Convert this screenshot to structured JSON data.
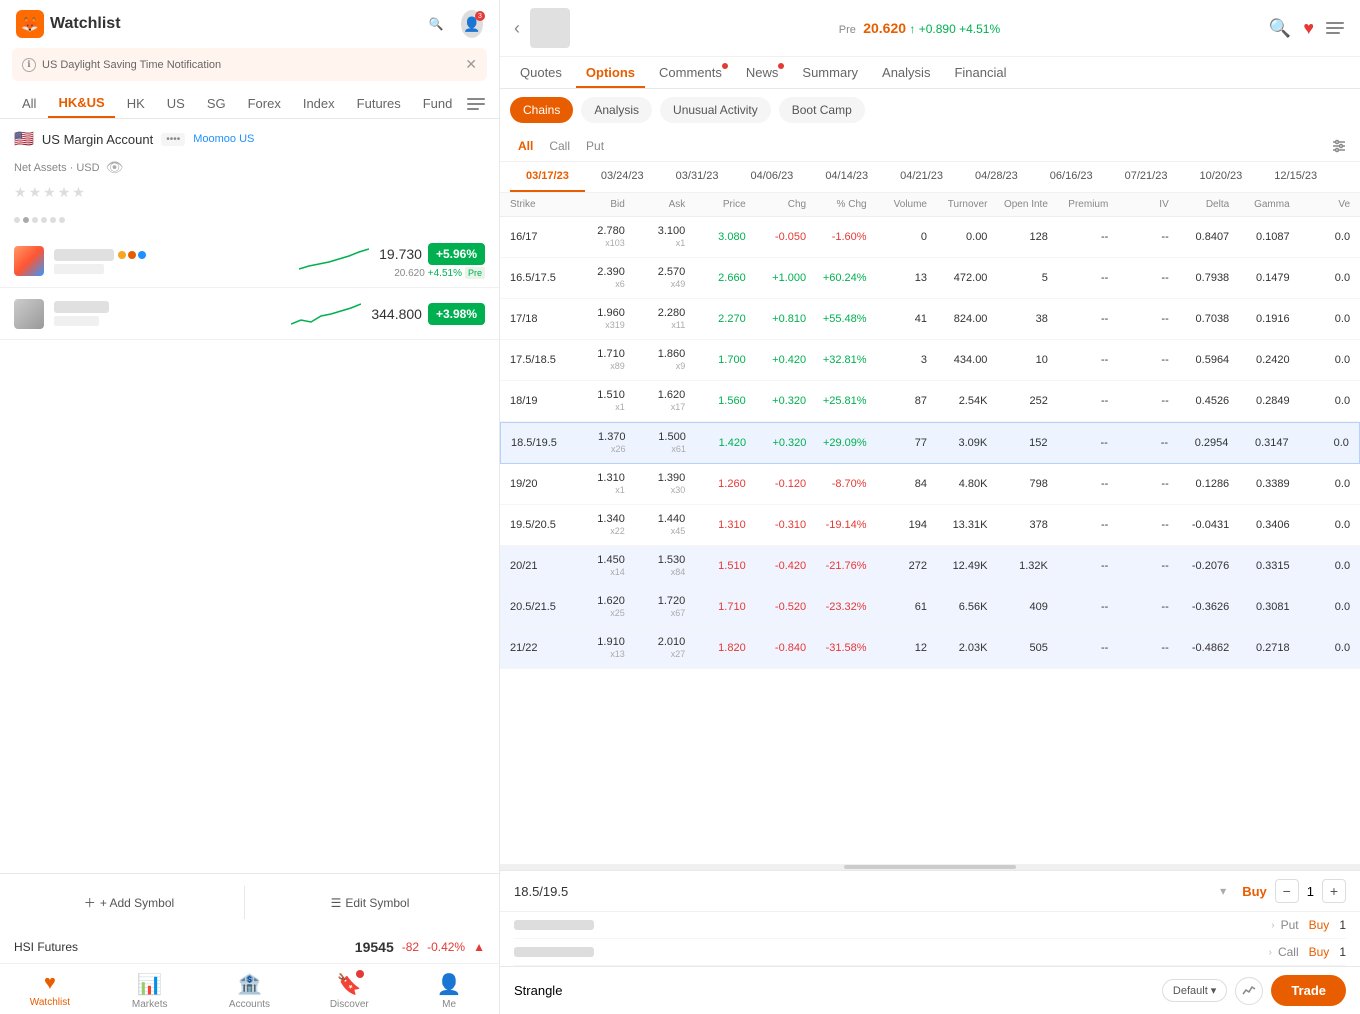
{
  "app": {
    "logo": "🦊",
    "title": "Watchlist"
  },
  "notification": {
    "text": "US Daylight Saving Time Notification",
    "icon": "ℹ"
  },
  "tabs": [
    {
      "label": "All",
      "active": false
    },
    {
      "label": "HK&US",
      "active": true
    },
    {
      "label": "HK",
      "active": false
    },
    {
      "label": "US",
      "active": false
    },
    {
      "label": "SG",
      "active": false
    },
    {
      "label": "Forex",
      "active": false
    },
    {
      "label": "Index",
      "active": false
    },
    {
      "label": "Futures",
      "active": false
    },
    {
      "label": "Funds",
      "active": false
    }
  ],
  "account": {
    "flag": "🇺🇸",
    "name": "US Margin Account",
    "badge": "••••",
    "broker": "Moomoo US",
    "assets_label": "Net Assets · USD"
  },
  "stocks": [
    {
      "price": "19.730",
      "change": "+5.96%",
      "sub_price": "20.620",
      "sub_change": "+4.51%",
      "sub_label": "Pre",
      "badge_color": "badge-green"
    },
    {
      "price": "344.800",
      "change": "+3.98%",
      "badge_color": "badge-green2"
    }
  ],
  "actions": {
    "add_symbol": "+ Add Symbol",
    "edit_symbol": "Edit Symbol"
  },
  "hsi": {
    "label": "HSI Futures",
    "price": "19545",
    "change": "-82",
    "pct": "-0.42%"
  },
  "nav": [
    {
      "label": "Watchlist",
      "icon": "♥",
      "active": true
    },
    {
      "label": "Markets",
      "icon": "📊",
      "active": false
    },
    {
      "label": "Accounts",
      "icon": "🏦",
      "active": false
    },
    {
      "label": "Discover",
      "icon": "🔍",
      "active": false,
      "badge": true
    },
    {
      "label": "Me",
      "icon": "👤",
      "active": false
    }
  ],
  "right_header": {
    "pre_label": "Pre",
    "price": "20.620",
    "change": "+0.890",
    "pct": "+4.51%"
  },
  "main_tabs": [
    {
      "label": "Quotes",
      "active": false
    },
    {
      "label": "Options",
      "active": true
    },
    {
      "label": "Comments",
      "active": false,
      "dot": true
    },
    {
      "label": "News",
      "active": false,
      "dot": true
    },
    {
      "label": "Summary",
      "active": false
    },
    {
      "label": "Analysis",
      "active": false
    },
    {
      "label": "Financial",
      "active": false
    }
  ],
  "subtabs": [
    {
      "label": "Chains",
      "active": true
    },
    {
      "label": "Analysis",
      "active": false
    },
    {
      "label": "Unusual Activity",
      "active": false
    },
    {
      "label": "Boot Camp",
      "active": false
    }
  ],
  "filters": [
    {
      "label": "All",
      "active": true
    },
    {
      "label": "Call",
      "active": false
    },
    {
      "label": "Put",
      "active": false
    }
  ],
  "dates": [
    {
      "date": "03/17/23",
      "active": true
    },
    {
      "date": "03/24/23",
      "active": false
    },
    {
      "date": "03/31/23",
      "active": false
    },
    {
      "date": "04/06/23",
      "active": false
    },
    {
      "date": "04/14/23",
      "active": false
    },
    {
      "date": "04/21/23",
      "active": false
    },
    {
      "date": "04/28/23",
      "active": false
    },
    {
      "date": "06/16/23",
      "active": false
    },
    {
      "date": "07/21/23",
      "active": false
    },
    {
      "date": "10/20/23",
      "active": false
    },
    {
      "date": "12/15/23",
      "active": false
    }
  ],
  "table_headers": [
    "Strike",
    "Bid",
    "Ask",
    "Price",
    "Chg",
    "% Chg",
    "Volume",
    "Turnover",
    "Open Inte",
    "Premium",
    "IV",
    "Delta",
    "Gamma",
    "Ve"
  ],
  "rows": [
    {
      "strike": "16/17",
      "bid": "2.780",
      "bid_x": "x103",
      "ask": "3.100",
      "ask_x": "x1",
      "price": "3.080",
      "chg": "-0.050",
      "pct_chg": "-1.60%",
      "volume": "0",
      "turnover": "0.00",
      "open_int": "128",
      "premium": "--",
      "iv": "--",
      "delta": "0.8407",
      "gamma": "0.1087",
      "ve": "0.0",
      "shaded": false,
      "highlighted": false
    },
    {
      "strike": "16.5/17.5",
      "bid": "2.390",
      "bid_x": "x6",
      "ask": "2.570",
      "ask_x": "x49",
      "price": "2.660",
      "chg": "+1.000",
      "pct_chg": "+60.24%",
      "volume": "13",
      "turnover": "472.00",
      "open_int": "5",
      "premium": "--",
      "iv": "--",
      "delta": "0.7938",
      "gamma": "0.1479",
      "ve": "0.0",
      "shaded": false,
      "highlighted": false
    },
    {
      "strike": "17/18",
      "bid": "1.960",
      "bid_x": "x319",
      "ask": "2.280",
      "ask_x": "x11",
      "price": "2.270",
      "chg": "+0.810",
      "pct_chg": "+55.48%",
      "volume": "41",
      "turnover": "824.00",
      "open_int": "38",
      "premium": "--",
      "iv": "--",
      "delta": "0.7038",
      "gamma": "0.1916",
      "ve": "0.0",
      "shaded": false,
      "highlighted": false
    },
    {
      "strike": "17.5/18.5",
      "bid": "1.710",
      "bid_x": "x89",
      "ask": "1.860",
      "ask_x": "x9",
      "price": "1.700",
      "chg": "+0.420",
      "pct_chg": "+32.81%",
      "volume": "3",
      "turnover": "434.00",
      "open_int": "10",
      "premium": "--",
      "iv": "--",
      "delta": "0.5964",
      "gamma": "0.2420",
      "ve": "0.0",
      "shaded": false,
      "highlighted": false
    },
    {
      "strike": "18/19",
      "bid": "1.510",
      "bid_x": "x1",
      "ask": "1.620",
      "ask_x": "x17",
      "price": "1.560",
      "chg": "+0.320",
      "pct_chg": "+25.81%",
      "volume": "87",
      "turnover": "2.54K",
      "open_int": "252",
      "premium": "--",
      "iv": "--",
      "delta": "0.4526",
      "gamma": "0.2849",
      "ve": "0.0",
      "shaded": false,
      "highlighted": false
    },
    {
      "strike": "18.5/19.5",
      "bid": "1.370",
      "bid_x": "x26",
      "ask": "1.500",
      "ask_x": "x61",
      "price": "1.420",
      "chg": "+0.320",
      "pct_chg": "+29.09%",
      "volume": "77",
      "turnover": "3.09K",
      "open_int": "152",
      "premium": "--",
      "iv": "--",
      "delta": "0.2954",
      "gamma": "0.3147",
      "ve": "0.0",
      "shaded": false,
      "highlighted": true
    },
    {
      "strike": "19/20",
      "bid": "1.310",
      "bid_x": "x1",
      "ask": "1.390",
      "ask_x": "x30",
      "price": "1.260",
      "chg": "-0.120",
      "pct_chg": "-8.70%",
      "volume": "84",
      "turnover": "4.80K",
      "open_int": "798",
      "premium": "--",
      "iv": "--",
      "delta": "0.1286",
      "gamma": "0.3389",
      "ve": "0.0",
      "shaded": false,
      "highlighted": false
    },
    {
      "strike": "19.5/20.5",
      "bid": "1.340",
      "bid_x": "x22",
      "ask": "1.440",
      "ask_x": "x45",
      "price": "1.310",
      "chg": "-0.310",
      "pct_chg": "-19.14%",
      "volume": "194",
      "turnover": "13.31K",
      "open_int": "378",
      "premium": "--",
      "iv": "--",
      "delta": "-0.0431",
      "gamma": "0.3406",
      "ve": "0.0",
      "shaded": false,
      "highlighted": false
    },
    {
      "strike": "20/21",
      "bid": "1.450",
      "bid_x": "x14",
      "ask": "1.530",
      "ask_x": "x84",
      "price": "1.510",
      "chg": "-0.420",
      "pct_chg": "-21.76%",
      "volume": "272",
      "turnover": "12.49K",
      "open_int": "1.32K",
      "premium": "--",
      "iv": "--",
      "delta": "-0.2076",
      "gamma": "0.3315",
      "ve": "0.0",
      "shaded": true,
      "highlighted": false
    },
    {
      "strike": "20.5/21.5",
      "bid": "1.620",
      "bid_x": "x25",
      "ask": "1.720",
      "ask_x": "x67",
      "price": "1.710",
      "chg": "-0.520",
      "pct_chg": "-23.32%",
      "volume": "61",
      "turnover": "6.56K",
      "open_int": "409",
      "premium": "--",
      "iv": "--",
      "delta": "-0.3626",
      "gamma": "0.3081",
      "ve": "0.0",
      "shaded": true,
      "highlighted": false
    },
    {
      "strike": "21/22",
      "bid": "1.910",
      "bid_x": "x13",
      "ask": "2.010",
      "ask_x": "x27",
      "price": "1.820",
      "chg": "-0.840",
      "pct_chg": "-31.58%",
      "volume": "12",
      "turnover": "2.03K",
      "open_int": "505",
      "premium": "--",
      "iv": "--",
      "delta": "-0.4862",
      "gamma": "0.2718",
      "ve": "0.0",
      "shaded": true,
      "highlighted": false
    }
  ],
  "trade_bar": {
    "symbol": "18.5/19.5",
    "action": "Buy",
    "qty": "1",
    "plus": "+",
    "minus": "−"
  },
  "order_rows": [
    {
      "type": "Put",
      "action": "Buy",
      "qty": "1"
    },
    {
      "type": "Call",
      "action": "Buy",
      "qty": "1"
    }
  ],
  "strangle": {
    "label": "Strangle",
    "default": "Default",
    "trade": "Trade"
  }
}
